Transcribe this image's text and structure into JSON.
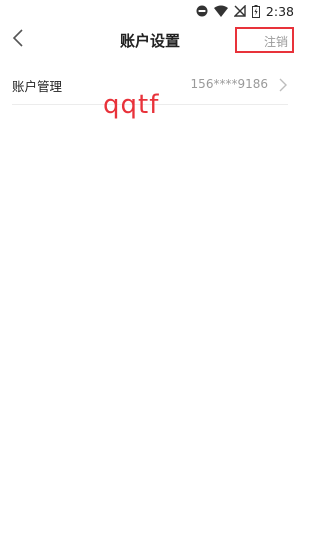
{
  "status_bar": {
    "time": "2:38",
    "icons": [
      "do-not-disturb-icon",
      "wifi-icon",
      "no-signal-icon",
      "battery-icon"
    ]
  },
  "header": {
    "title": "账户设置",
    "cancel_label": "注销",
    "back_icon": "chevron-left-icon"
  },
  "settings": {
    "items": [
      {
        "label": "账户管理",
        "value": "156****9186",
        "icon": "chevron-right-icon"
      }
    ]
  },
  "overlay": {
    "text": "qqtf",
    "color": "#e8323a"
  },
  "colors": {
    "highlight": "#e8323a",
    "secondary_text": "#9a9a9a"
  }
}
